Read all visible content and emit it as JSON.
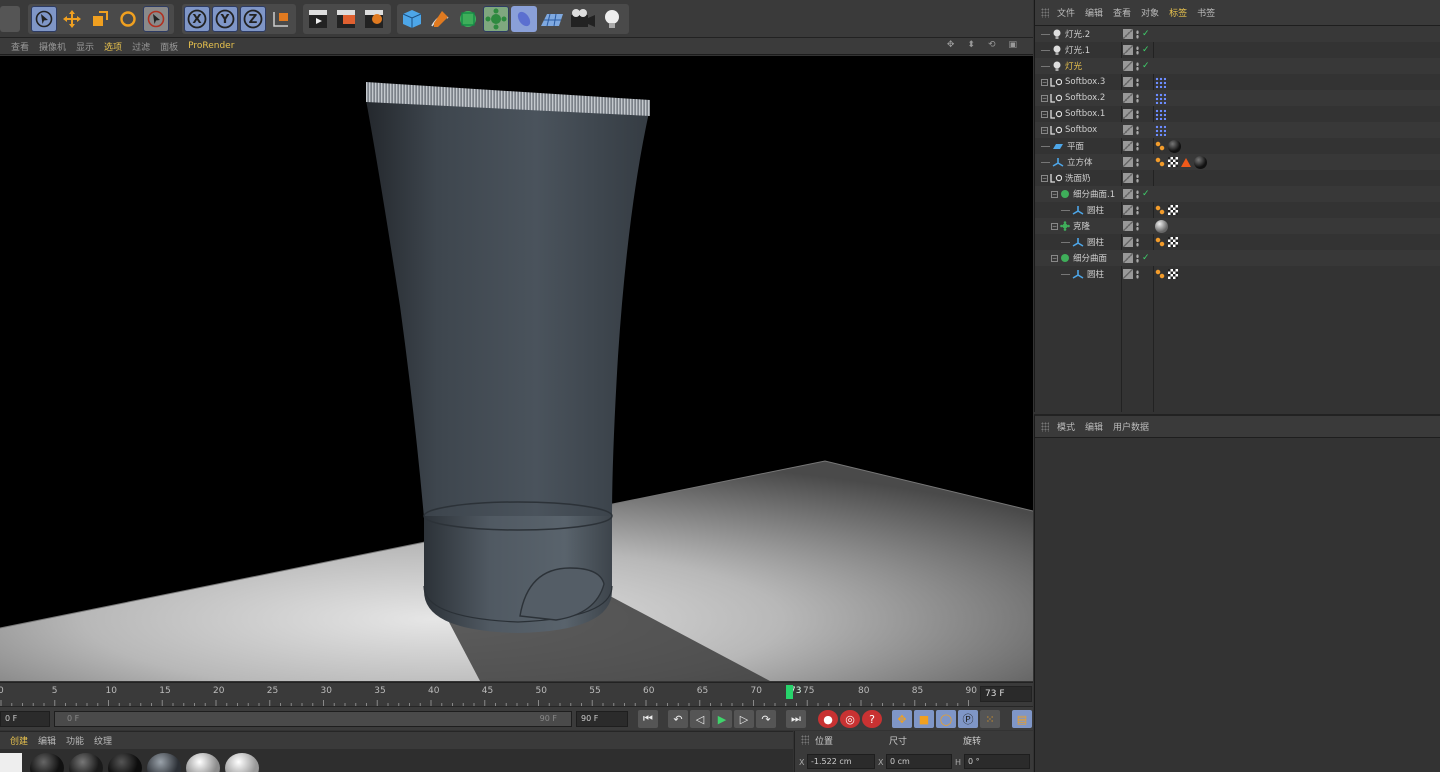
{
  "toolbar": {
    "axis_buttons": [
      "X",
      "Y",
      "Z"
    ]
  },
  "viewport_menu": {
    "items": [
      "查看",
      "摄像机",
      "显示",
      "选项",
      "过滤",
      "面板",
      "ProRender"
    ],
    "active": "选项"
  },
  "timeline": {
    "ticks": [
      "0",
      "5",
      "10",
      "15",
      "20",
      "25",
      "30",
      "35",
      "40",
      "45",
      "50",
      "55",
      "60",
      "65",
      "70",
      "73",
      "75",
      "80",
      "85",
      "90"
    ],
    "current_frame": 73,
    "frame_field": "73 F"
  },
  "transport": {
    "start_field": "0 F",
    "range_start": "0 F",
    "range_end": "90 F",
    "end_field": "90 F"
  },
  "material_manager": {
    "menu": [
      "创建",
      "编辑",
      "功能",
      "纹理"
    ],
    "active": "创建"
  },
  "coordinates": {
    "headers": [
      "位置",
      "尺寸",
      "旋转"
    ],
    "axis_label": "X",
    "position_x": "-1.522 cm",
    "size_axis_label": "X",
    "size_x": "0 cm",
    "rotation_label": "H",
    "rotation_h": "0 °"
  },
  "object_manager": {
    "menu": [
      "文件",
      "编辑",
      "查看",
      "对象",
      "标签",
      "书签"
    ],
    "active": "标签",
    "objects": [
      {
        "name": "灯光.2",
        "icon": "light-icon",
        "indent": 0,
        "highlight": false,
        "tags": []
      },
      {
        "name": "灯光.1",
        "icon": "light-icon",
        "indent": 0,
        "highlight": false,
        "tags": []
      },
      {
        "name": "灯光",
        "icon": "light-icon",
        "indent": 0,
        "highlight": true,
        "tags": []
      },
      {
        "name": "Softbox.3",
        "icon": "null-icon",
        "indent": 0,
        "highlight": false,
        "tags": [
          "dots"
        ]
      },
      {
        "name": "Softbox.2",
        "icon": "null-icon",
        "indent": 0,
        "highlight": false,
        "tags": [
          "dots"
        ]
      },
      {
        "name": "Softbox.1",
        "icon": "null-icon",
        "indent": 0,
        "highlight": false,
        "tags": [
          "dots"
        ]
      },
      {
        "name": "Softbox",
        "icon": "null-icon",
        "indent": 0,
        "highlight": false,
        "tags": [
          "dots"
        ]
      },
      {
        "name": "平面",
        "icon": "plane-icon",
        "indent": 0,
        "highlight": false,
        "tags": [
          "phong",
          "material-black"
        ]
      },
      {
        "name": "立方体",
        "icon": "cube-icon",
        "indent": 0,
        "highlight": false,
        "tags": [
          "phong",
          "checker",
          "cone",
          "material-black"
        ]
      },
      {
        "name": "洗面奶",
        "icon": "null-icon",
        "indent": 0,
        "highlight": false,
        "tags": []
      },
      {
        "name": "细分曲面.1",
        "icon": "subdivision-icon",
        "indent": 1,
        "highlight": false,
        "tags": []
      },
      {
        "name": "圆柱",
        "icon": "cylinder-icon",
        "indent": 2,
        "highlight": false,
        "tags": [
          "phong",
          "checker"
        ]
      },
      {
        "name": "克隆",
        "icon": "cloner-icon",
        "indent": 1,
        "highlight": false,
        "tags": [
          "material-grey"
        ]
      },
      {
        "name": "圆柱",
        "icon": "cylinder-icon",
        "indent": 2,
        "highlight": false,
        "tags": [
          "phong",
          "checker"
        ]
      },
      {
        "name": "细分曲面",
        "icon": "subdivision-icon",
        "indent": 1,
        "highlight": false,
        "tags": []
      },
      {
        "name": "圆柱",
        "icon": "cylinder-icon",
        "indent": 2,
        "highlight": false,
        "tags": [
          "phong",
          "checker"
        ]
      }
    ]
  },
  "attribute_manager": {
    "menu": [
      "模式",
      "编辑",
      "用户数据"
    ]
  }
}
